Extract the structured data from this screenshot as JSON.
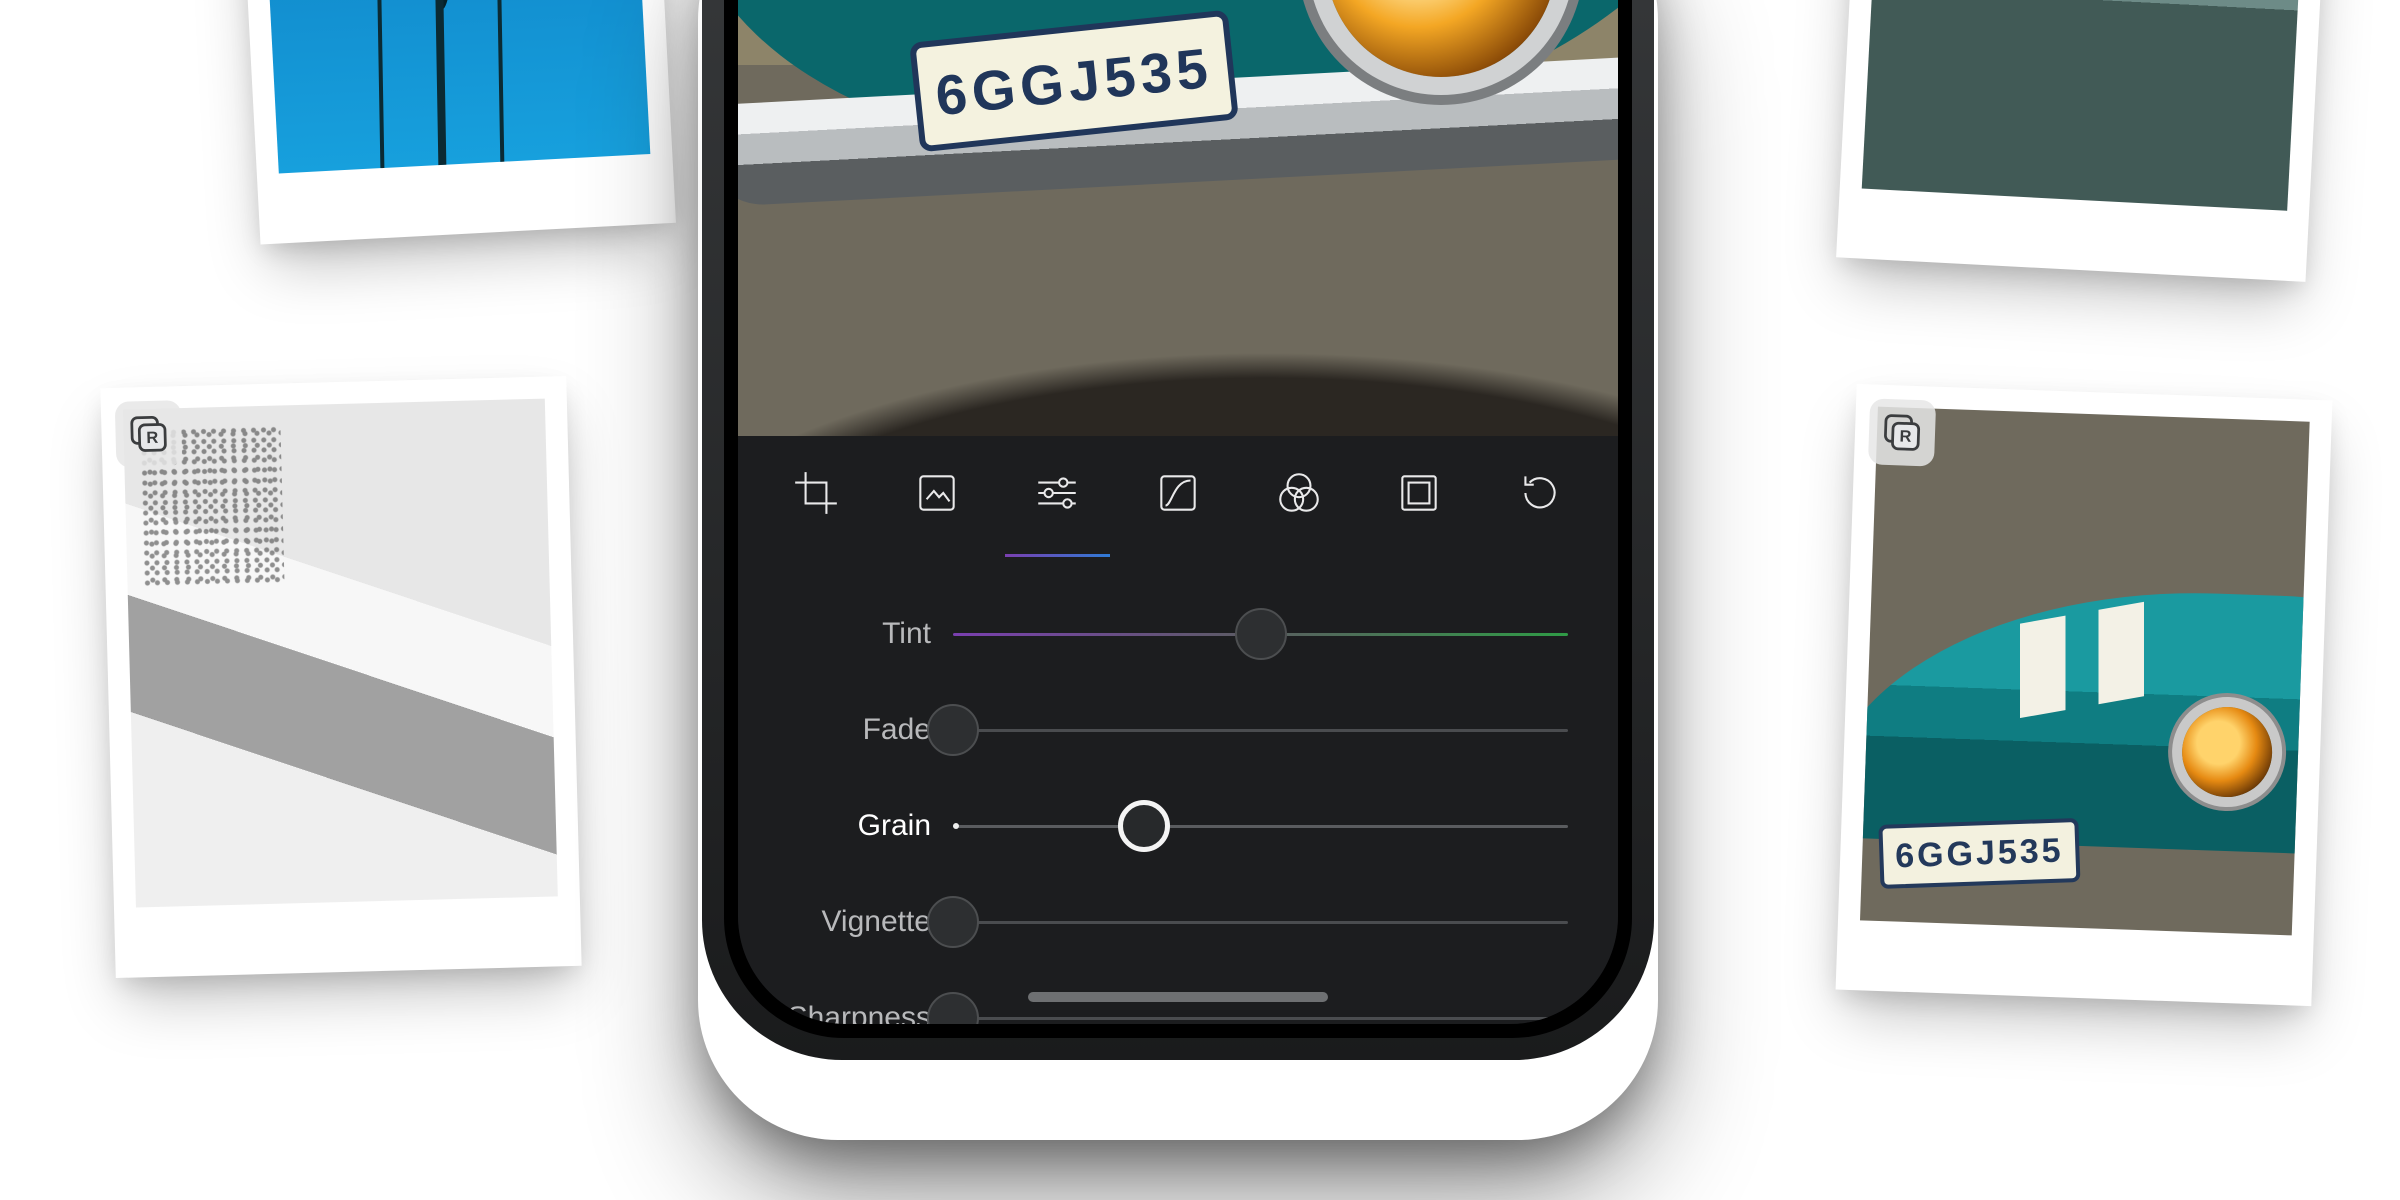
{
  "license_plate": "6GGJ535",
  "thumb_plate": "6GGJ535",
  "toolbar": {
    "items": [
      {
        "name": "crop"
      },
      {
        "name": "frame"
      },
      {
        "name": "adjust"
      },
      {
        "name": "curves"
      },
      {
        "name": "filters"
      },
      {
        "name": "border"
      },
      {
        "name": "history"
      }
    ],
    "active_index": 2
  },
  "sliders": [
    {
      "key": "tint",
      "label": "Tint",
      "pos": 0.5,
      "active": false,
      "gradient": true
    },
    {
      "key": "fade",
      "label": "Fade",
      "pos": 0.0,
      "active": false,
      "gradient": false
    },
    {
      "key": "grain",
      "label": "Grain",
      "pos": 0.31,
      "active": true,
      "gradient": false
    },
    {
      "key": "vignette",
      "label": "Vignette",
      "pos": 0.0,
      "active": false,
      "gradient": false
    },
    {
      "key": "sharpness",
      "label": "Sharpness",
      "pos": 0.0,
      "active": false,
      "gradient": false
    }
  ],
  "badges": {
    "r": "R"
  },
  "colors": {
    "panel": "#1c1d1f",
    "accent_purple": "#7a3fb0",
    "accent_green": "#2f9b46",
    "teal": "#1fa7ad"
  }
}
